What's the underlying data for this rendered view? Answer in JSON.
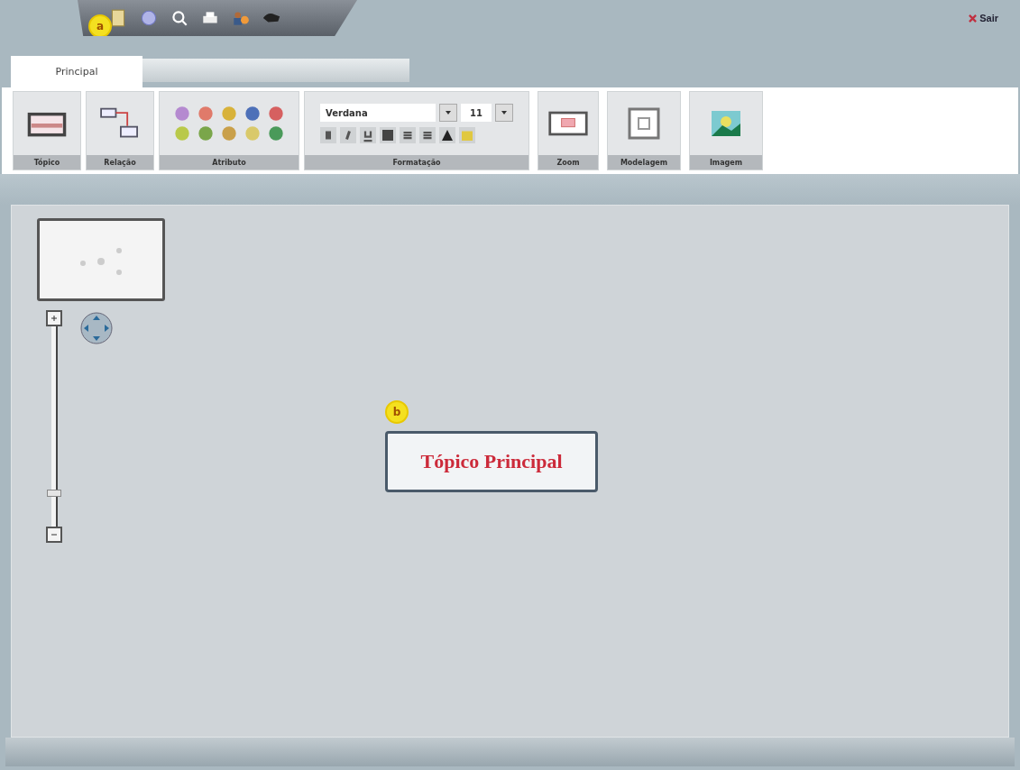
{
  "quick_access": {
    "badge": "a"
  },
  "exit_button": {
    "label": "Sair"
  },
  "tabs": [
    {
      "label": "Principal",
      "selected": true
    }
  ],
  "ribbon": {
    "groups": [
      {
        "kind": "topic",
        "label": "Tópico"
      },
      {
        "kind": "relation",
        "label": "Relação"
      },
      {
        "kind": "attributes",
        "label": "Atributo"
      },
      {
        "kind": "format",
        "label": "Formatação",
        "font": "Verdana",
        "size": "11"
      },
      {
        "kind": "zoom",
        "label": "Zoom"
      },
      {
        "kind": "model",
        "label": "Modelagem"
      },
      {
        "kind": "image",
        "label": "Imagem"
      }
    ]
  },
  "canvas": {
    "zoom_slider": {
      "level": 0.15
    },
    "topic": {
      "label": "Tópico Principal",
      "badge": "b"
    }
  }
}
